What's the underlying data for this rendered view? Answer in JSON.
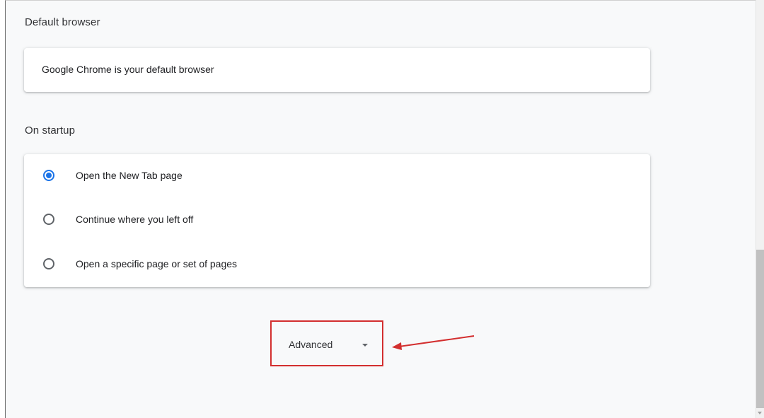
{
  "default_browser": {
    "section_title": "Default browser",
    "status_text": "Google Chrome is your default browser"
  },
  "on_startup": {
    "section_title": "On startup",
    "options": [
      {
        "label": "Open the New Tab page",
        "selected": true
      },
      {
        "label": "Continue where you left off",
        "selected": false
      },
      {
        "label": "Open a specific page or set of pages",
        "selected": false
      }
    ]
  },
  "advanced": {
    "label": "Advanced",
    "icon": "caret-down-icon"
  },
  "annotation": {
    "highlight_color": "#d32f2f",
    "arrow_icon": "red-arrow-icon"
  },
  "colors": {
    "accent": "#1a73e8",
    "page_background": "#f8f9fa",
    "card_background": "#ffffff"
  }
}
